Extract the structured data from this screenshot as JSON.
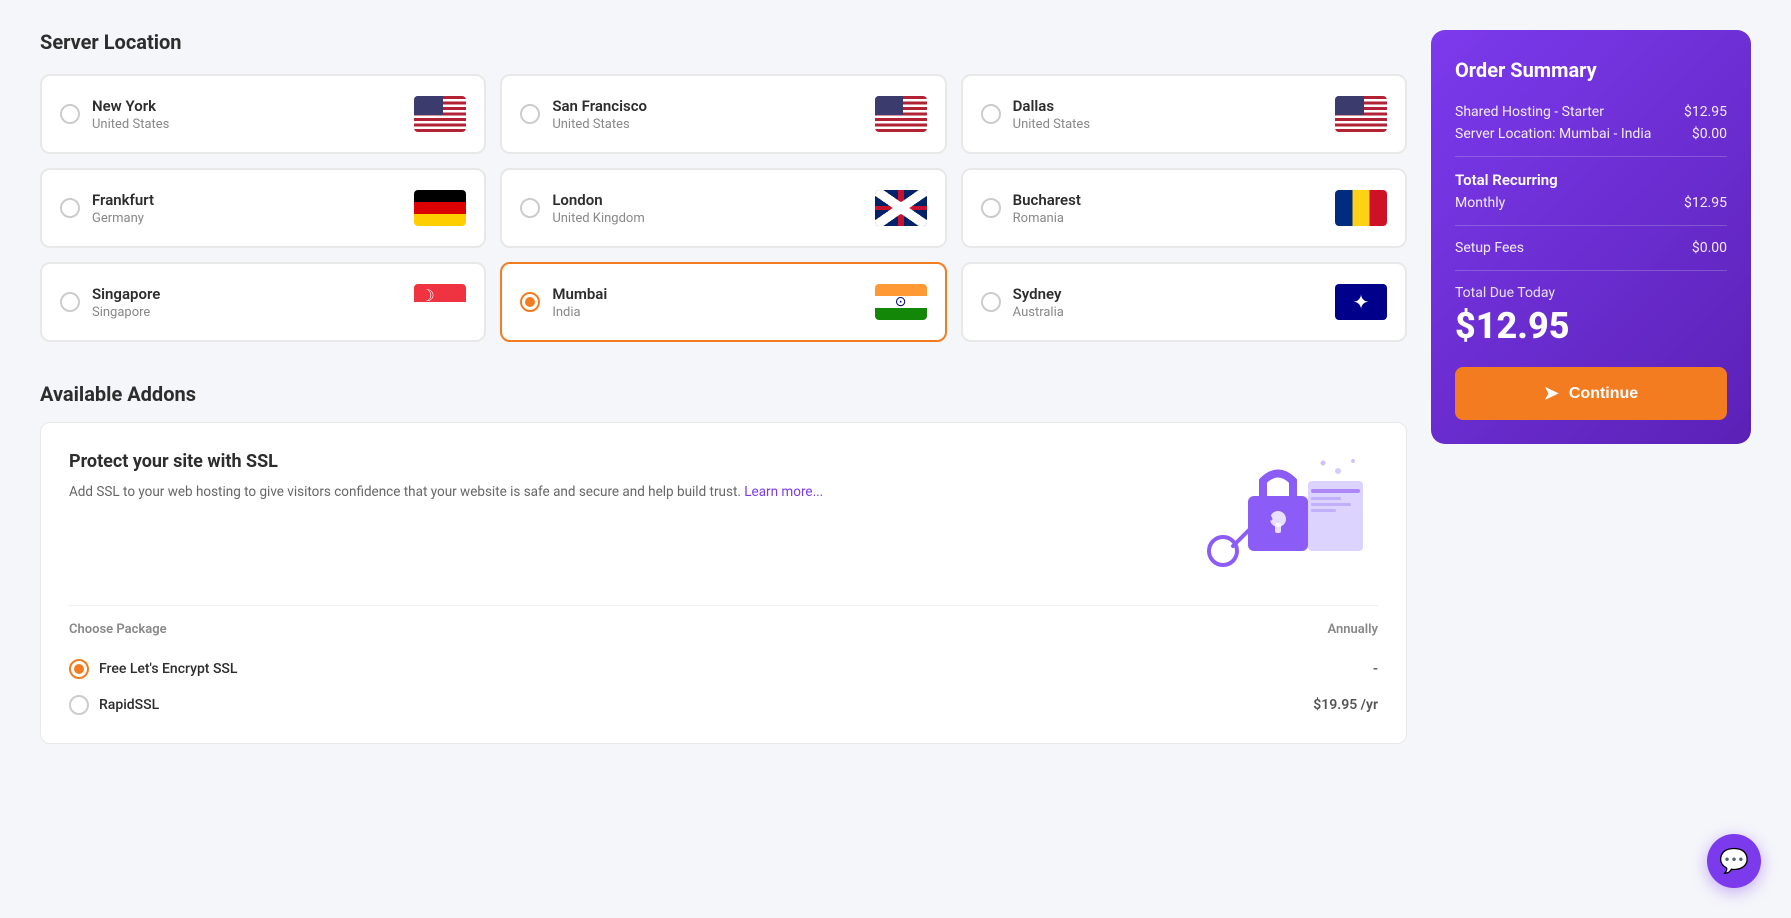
{
  "page": {
    "title": "Server Location"
  },
  "locations": [
    {
      "id": "new-york",
      "name": "New York",
      "country": "United States",
      "flag": "us",
      "selected": false
    },
    {
      "id": "san-francisco",
      "name": "San Francisco",
      "country": "United States",
      "flag": "us",
      "selected": false
    },
    {
      "id": "dallas",
      "name": "Dallas",
      "country": "United States",
      "flag": "us",
      "selected": false
    },
    {
      "id": "frankfurt",
      "name": "Frankfurt",
      "country": "Germany",
      "flag": "de",
      "selected": false
    },
    {
      "id": "london",
      "name": "London",
      "country": "United Kingdom",
      "flag": "uk",
      "selected": false
    },
    {
      "id": "bucharest",
      "name": "Bucharest",
      "country": "Romania",
      "flag": "ro",
      "selected": false
    },
    {
      "id": "singapore",
      "name": "Singapore",
      "country": "Singapore",
      "flag": "sg",
      "selected": false
    },
    {
      "id": "mumbai",
      "name": "Mumbai",
      "country": "India",
      "flag": "in",
      "selected": true
    },
    {
      "id": "sydney",
      "name": "Sydney",
      "country": "Australia",
      "flag": "au",
      "selected": false
    }
  ],
  "addons": {
    "section_title": "Available Addons",
    "ssl": {
      "title": "Protect your site with SSL",
      "description": "Add SSL to your web hosting to give visitors confidence that your website is safe and secure and help build trust.",
      "learn_more": "Learn more...",
      "package_label": "Choose Package",
      "billing_label": "Annually",
      "options": [
        {
          "id": "free-ssl",
          "name": "Free Let's Encrypt SSL",
          "price": "-",
          "selected": true
        },
        {
          "id": "rapidssl",
          "name": "RapidSSL",
          "price": "$19.95 /yr",
          "selected": false
        }
      ]
    }
  },
  "order_summary": {
    "title": "Order Summary",
    "line_items": [
      {
        "label": "Shared Hosting - Starter",
        "value": "$12.95"
      },
      {
        "label": "Server Location: Mumbai - India",
        "value": "$0.00"
      }
    ],
    "total_recurring_label": "Total Recurring",
    "monthly_label": "Monthly",
    "monthly_value": "$12.95",
    "setup_fees_label": "Setup Fees",
    "setup_fees_value": "$0.00",
    "total_due_label": "Total Due Today",
    "total_amount": "$12.95",
    "continue_label": "Continue"
  },
  "chat": {
    "icon": "💬"
  }
}
